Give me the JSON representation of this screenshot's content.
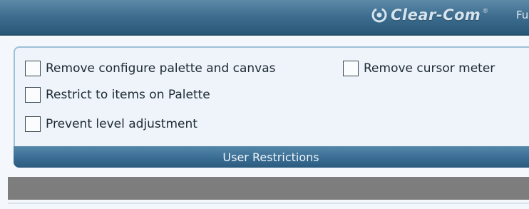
{
  "header": {
    "brand": "Clear-Com",
    "brand_tm": "®",
    "menu_partial": "Fu",
    "logo_icon": "clear-com-logo-icon"
  },
  "restrictions": {
    "title": "User Restrictions",
    "options": [
      {
        "label": "Remove configure palette and canvas",
        "checked": false
      },
      {
        "label": "Remove cursor meter",
        "checked": false
      },
      {
        "label": "Restrict to items on Palette",
        "checked": false
      },
      {
        "label": "Prevent level adjustment",
        "checked": false
      }
    ]
  }
}
